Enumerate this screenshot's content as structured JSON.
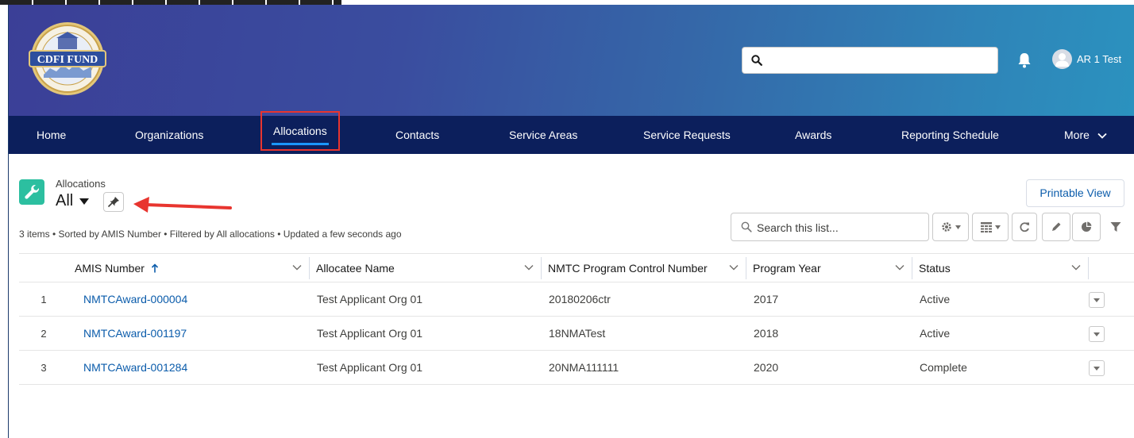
{
  "header": {
    "logo_text": "CDFI FUND",
    "search_placeholder": "",
    "user_name": "AR 1 Test"
  },
  "nav": {
    "items": [
      {
        "label": "Home"
      },
      {
        "label": "Organizations"
      },
      {
        "label": "Allocations",
        "active": true
      },
      {
        "label": "Contacts"
      },
      {
        "label": "Service Areas"
      },
      {
        "label": "Service Requests"
      },
      {
        "label": "Awards"
      },
      {
        "label": "Reporting Schedule"
      },
      {
        "label": "More"
      }
    ]
  },
  "list": {
    "object_name": "Allocations",
    "view_name": "All",
    "printable_label": "Printable View",
    "info_text": "3 items • Sorted by AMIS Number • Filtered by All allocations • Updated a few seconds ago",
    "search_placeholder": "Search this list..."
  },
  "table": {
    "columns": [
      {
        "label": "AMIS Number",
        "sorted": "asc"
      },
      {
        "label": "Allocatee Name"
      },
      {
        "label": "NMTC Program Control Number"
      },
      {
        "label": "Program Year"
      },
      {
        "label": "Status"
      }
    ],
    "rows": [
      {
        "num": "1",
        "amis": "NMTCAward-000004",
        "allocatee": "Test Applicant Org 01",
        "control": "20180206ctr",
        "year": "2017",
        "status": "Active"
      },
      {
        "num": "2",
        "amis": "NMTCAward-001197",
        "allocatee": "Test Applicant Org 01",
        "control": "18NMATest",
        "year": "2018",
        "status": "Active"
      },
      {
        "num": "3",
        "amis": "NMTCAward-001284",
        "allocatee": "Test Applicant Org 01",
        "control": "20NMA111111",
        "year": "2020",
        "status": "Complete"
      }
    ]
  },
  "colors": {
    "nav_bg": "#0c1f5c",
    "accent_link": "#0b5cab",
    "object_icon": "#2cbfa0",
    "highlight_box": "#e8352f"
  }
}
